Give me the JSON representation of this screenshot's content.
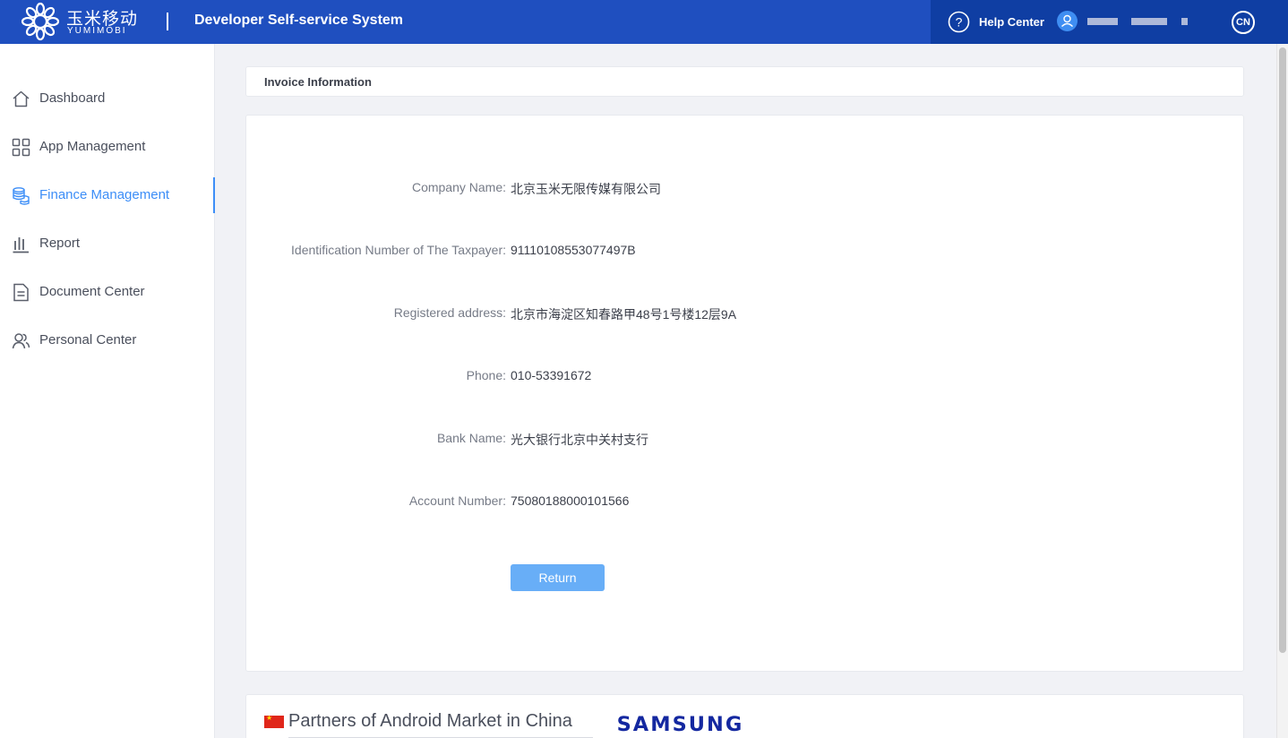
{
  "header": {
    "logo_cn": "玉米移动",
    "logo_en": "YUMIMOBI",
    "system_title": "Developer Self-service System",
    "help_label": "Help Center",
    "lang_label": "CN"
  },
  "sidebar": {
    "items": [
      {
        "label": "Dashboard",
        "icon": "home-icon",
        "active": false
      },
      {
        "label": "App Management",
        "icon": "grid-icon",
        "active": false
      },
      {
        "label": "Finance Management",
        "icon": "coins-icon",
        "active": true
      },
      {
        "label": "Report",
        "icon": "bar-chart-icon",
        "active": false
      },
      {
        "label": "Document Center",
        "icon": "document-icon",
        "active": false
      },
      {
        "label": "Personal Center",
        "icon": "users-icon",
        "active": false
      }
    ]
  },
  "main": {
    "section_title": "Invoice Information",
    "fields": [
      {
        "label": "Company Name:",
        "value": "北京玉米无限传媒有限公司"
      },
      {
        "label": "Identification Number of The Taxpayer:",
        "value": "91110108553077497B"
      },
      {
        "label": "Registered address:",
        "value": "北京市海淀区知春路甲48号1号楼12层9A"
      },
      {
        "label": "Phone:",
        "value": "010-53391672"
      },
      {
        "label": "Bank Name:",
        "value": "光大银行北京中关村支行"
      },
      {
        "label": "Account Number:",
        "value": "75080188000101566"
      }
    ],
    "return_label": "Return"
  },
  "footer": {
    "partners_title": "Partners of Android Market in China",
    "partner_logo": "SAMSUNG"
  },
  "colors": {
    "header_bg": "#1f4fbf",
    "header_right_bg": "#0f3ea3",
    "accent": "#3d8ef7",
    "button": "#68aef7"
  }
}
